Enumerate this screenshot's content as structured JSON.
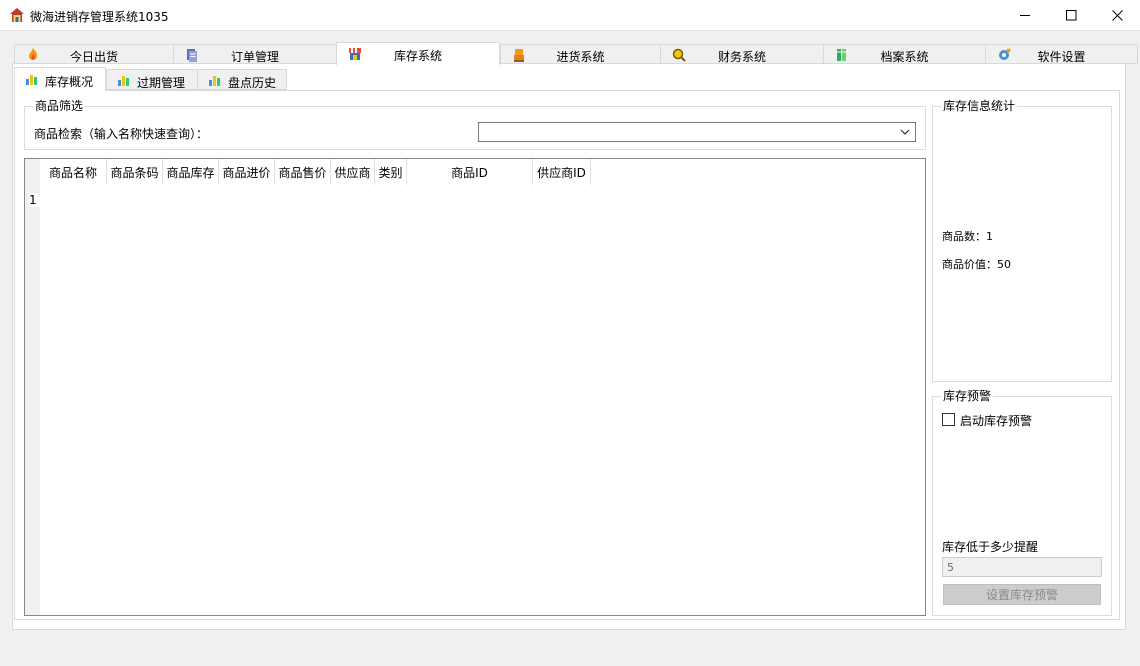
{
  "window": {
    "title": "微海进销存管理系统1035",
    "app_icon": "house-icon",
    "controls": {
      "minimize": "minimize-icon",
      "maximize": "maximize-icon",
      "close": "close-icon"
    }
  },
  "main_tabs": [
    {
      "label": "今日出货",
      "icon": "fire-icon",
      "active": false
    },
    {
      "label": "订单管理",
      "icon": "document-icon",
      "active": false
    },
    {
      "label": "库存系统",
      "icon": "storefront-icon",
      "active": true
    },
    {
      "label": "进货系统",
      "icon": "pallet-icon",
      "active": false
    },
    {
      "label": "财务系统",
      "icon": "magnifier-icon",
      "active": false
    },
    {
      "label": "档案系统",
      "icon": "binders-icon",
      "active": false
    },
    {
      "label": "软件设置",
      "icon": "gear-icon",
      "active": false
    }
  ],
  "sub_tabs": [
    {
      "label": "库存概况",
      "icon": "chart-icon",
      "active": true
    },
    {
      "label": "过期管理",
      "icon": "chart-icon",
      "active": false
    },
    {
      "label": "盘点历史",
      "icon": "chart-icon",
      "active": false
    }
  ],
  "filter": {
    "group_title": "商品筛选",
    "search_label": "商品检索（输入名称快速查询）：",
    "search_value": ""
  },
  "table": {
    "columns": [
      "商品名称",
      "商品条码",
      "商品库存",
      "商品进价",
      "商品售价",
      "供应商",
      "类别",
      "商品ID",
      "供应商ID"
    ],
    "row_numbers": [
      "1"
    ]
  },
  "stats": {
    "group_title": "库存信息统计",
    "product_count": "商品数：1",
    "product_value": "商品价值：50"
  },
  "warning": {
    "group_title": "库存预警",
    "enable_label": "启动库存预警",
    "enabled": false,
    "threshold_label": "库存低于多少提醒",
    "threshold_value": "5",
    "set_button": "设置库存预警"
  }
}
